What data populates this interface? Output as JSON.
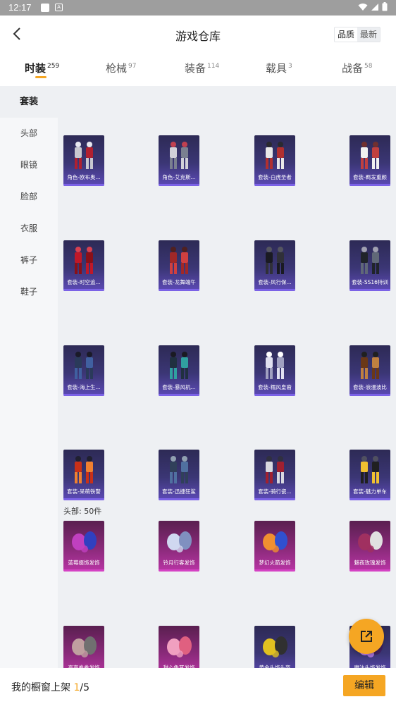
{
  "status_bar": {
    "time": "12:17",
    "sim_label": "A"
  },
  "header": {
    "title": "游戏仓库",
    "sort_quality": "品质",
    "sort_newest": "最新"
  },
  "tabs": [
    {
      "label": "时装",
      "count": "259"
    },
    {
      "label": "枪械",
      "count": "97"
    },
    {
      "label": "装备",
      "count": "114"
    },
    {
      "label": "载具",
      "count": "3"
    },
    {
      "label": "战备",
      "count": "58"
    }
  ],
  "sidebar": {
    "items": [
      "套装",
      "头部",
      "眼镜",
      "脸部",
      "衣服",
      "裤子",
      "鞋子"
    ]
  },
  "suits": [
    {
      "label": "角色-欧布奥...",
      "quality": "purple"
    },
    {
      "label": "角色-艾克斯...",
      "quality": "purple"
    },
    {
      "label": "套装-白虎圣者",
      "quality": "purple"
    },
    {
      "label": "套装-羁发重颜",
      "quality": "purple"
    },
    {
      "label": "套装-时空追...",
      "quality": "purple"
    },
    {
      "label": "套装-龙舞端午",
      "quality": "purple"
    },
    {
      "label": "套装-风行保...",
      "quality": "purple"
    },
    {
      "label": "套装-SS16特训",
      "quality": "purple"
    },
    {
      "label": "套装-海上生...",
      "quality": "purple"
    },
    {
      "label": "套装-暴风机...",
      "quality": "purple"
    },
    {
      "label": "套装-糯风皇裔",
      "quality": "purple"
    },
    {
      "label": "套装-浪漫波比",
      "quality": "purple"
    },
    {
      "label": "套装-呆萌铁警",
      "quality": "purple"
    },
    {
      "label": "套装-迅捷狂鲨",
      "quality": "purple"
    },
    {
      "label": "套装-骑行瓷...",
      "quality": "purple"
    },
    {
      "label": "套装-魅力单车",
      "quality": "purple"
    }
  ],
  "head_section": {
    "title": "头部: 50件"
  },
  "heads": [
    {
      "label": "蓝莓缀饰发饰",
      "quality": "pink"
    },
    {
      "label": "钤月行客发饰",
      "quality": "pink"
    },
    {
      "label": "梦幻火箭发饰",
      "quality": "pink"
    },
    {
      "label": "魅夜玫瑰发饰",
      "quality": "pink"
    },
    {
      "label": "亮亮卷卷发饰",
      "quality": "pink"
    },
    {
      "label": "甜心兔耳发饰",
      "quality": "pink"
    },
    {
      "label": "黄金头饰头盔",
      "quality": "purple"
    },
    {
      "label": "魔法头饰发饰",
      "quality": "purple"
    }
  ],
  "bottom_bar": {
    "text": "我的橱窗上架 ",
    "current": "1",
    "total": "/5",
    "edit_label": "编辑"
  },
  "colors": {
    "accent": "#f5a623",
    "purple_tile": "#3b3675",
    "pink_tile": "#8a2a7a"
  }
}
